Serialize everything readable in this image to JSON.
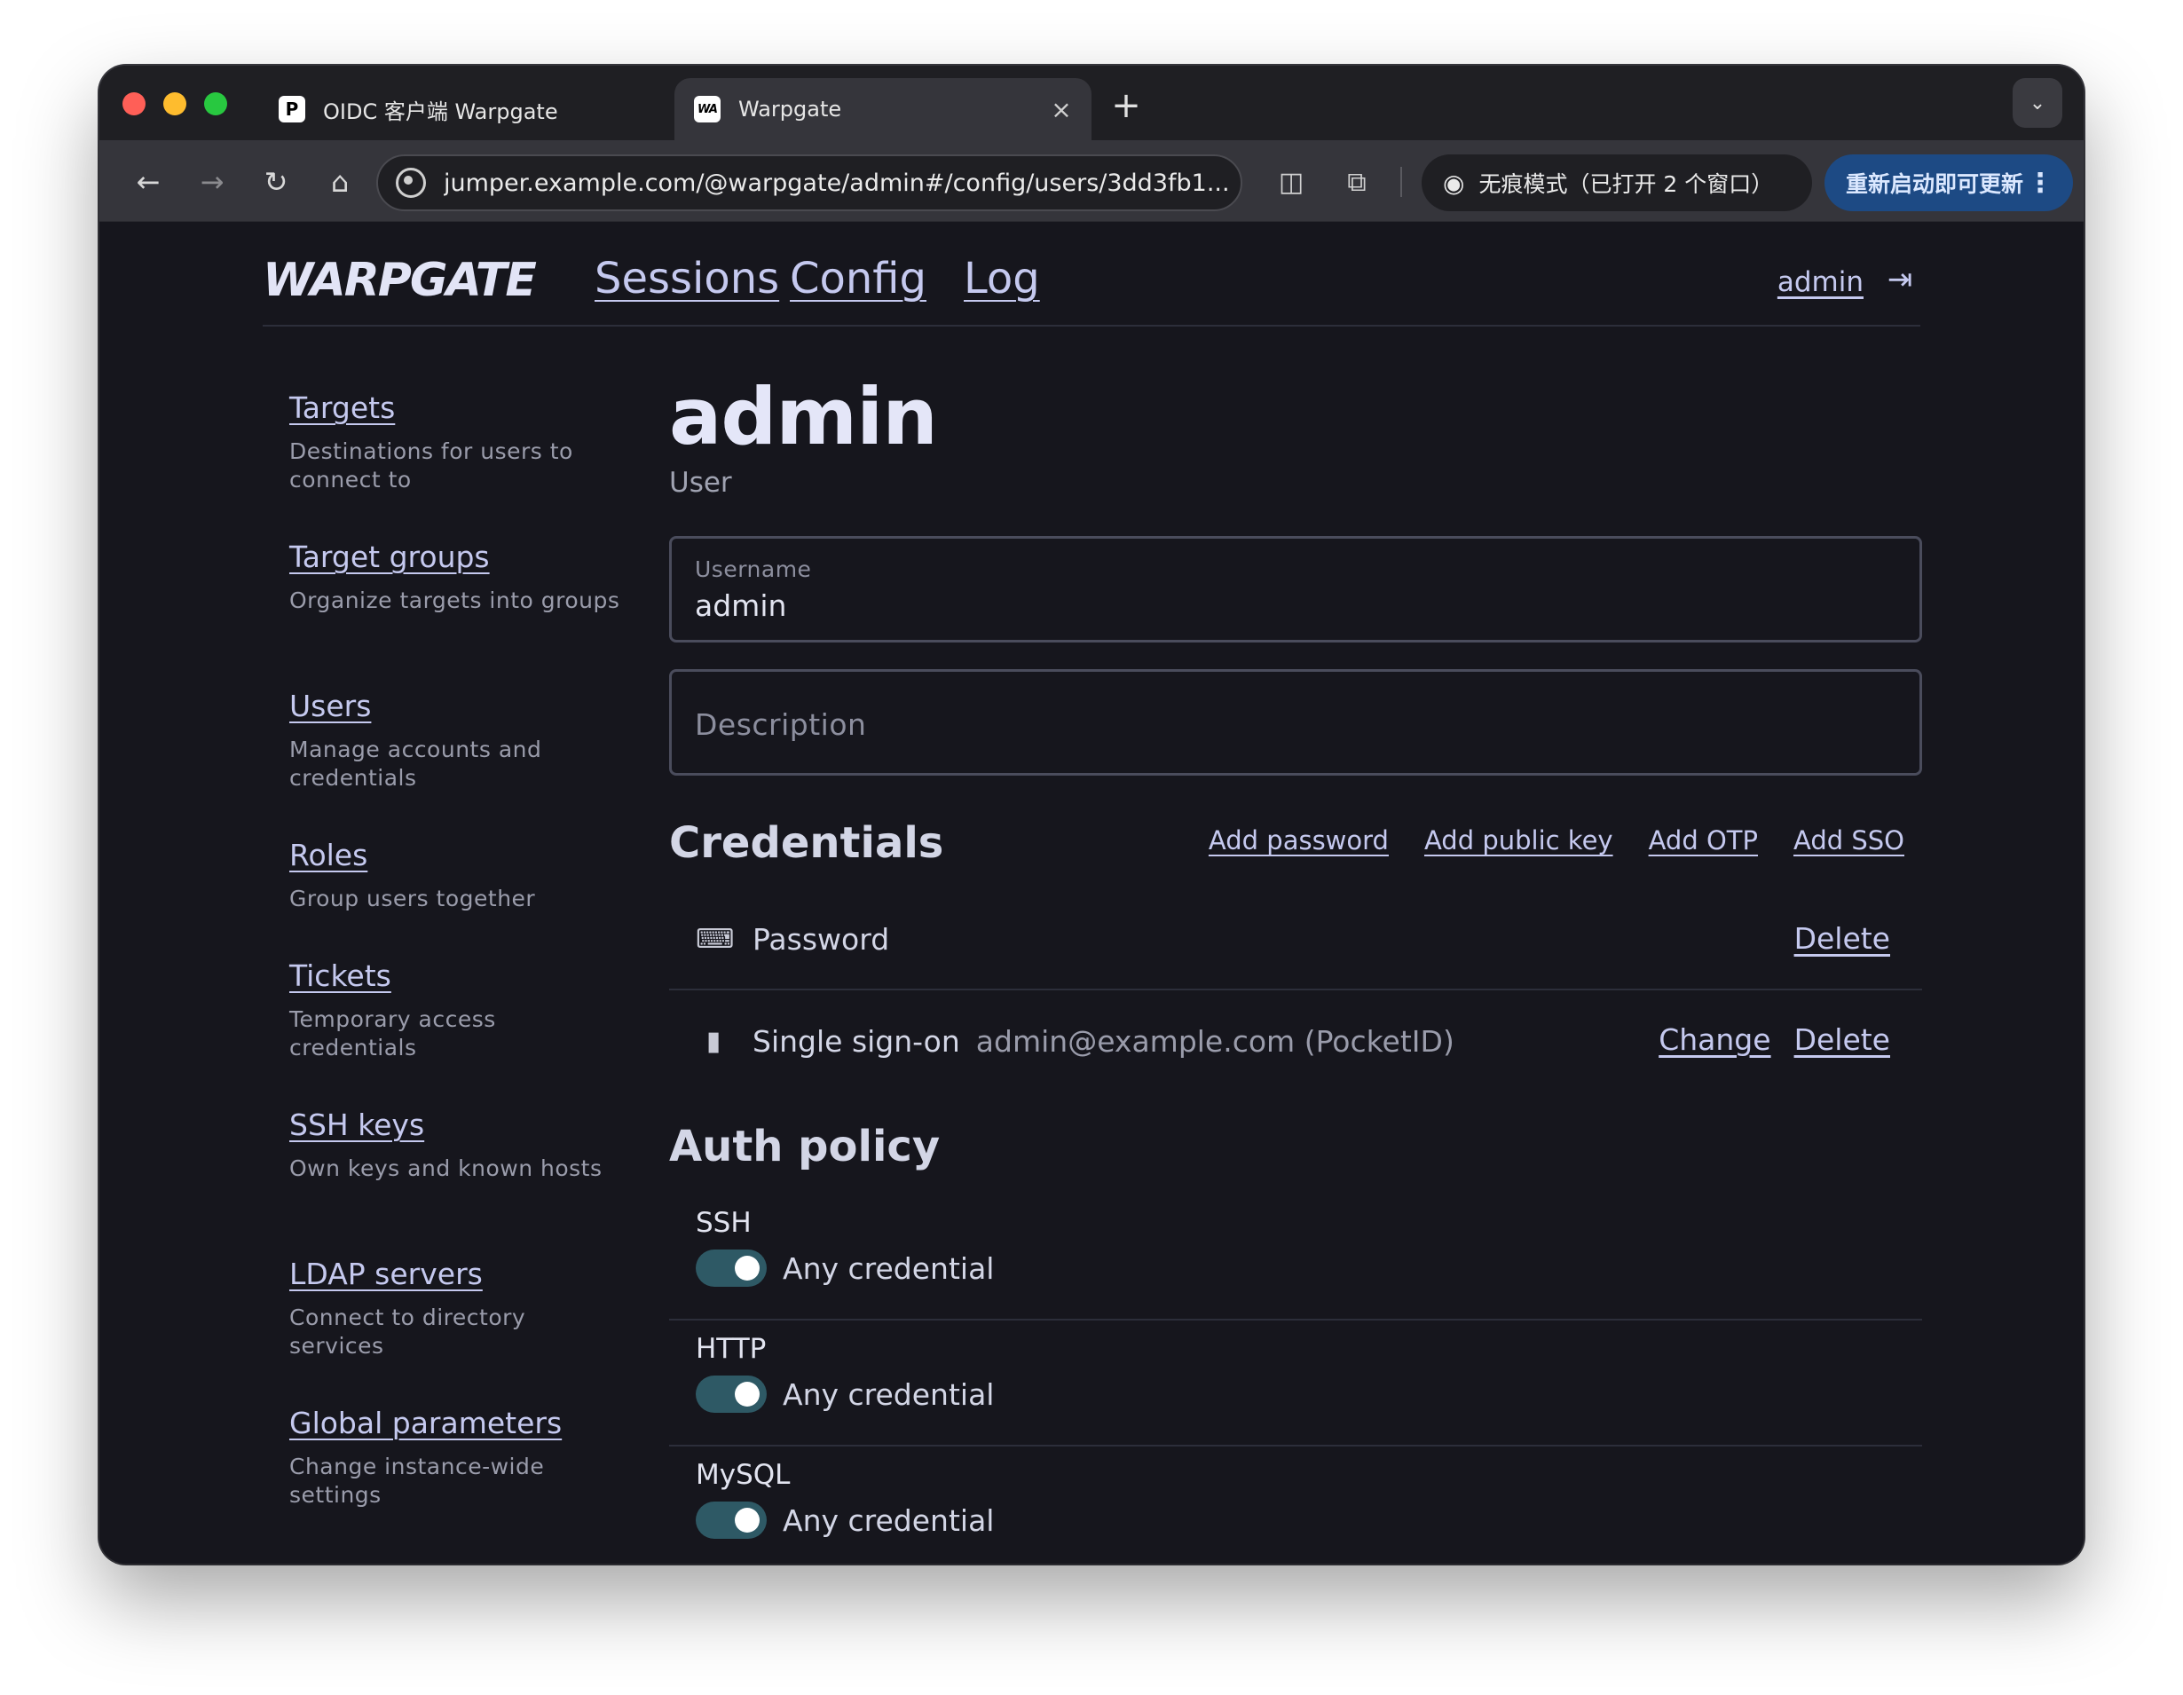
{
  "browser": {
    "tabs": [
      {
        "favicon": "P",
        "title": "OIDC 客户端 Warpgate",
        "close": "×"
      },
      {
        "favicon": "WA",
        "title": "Warpgate",
        "close": "×"
      }
    ],
    "new_tab": "+",
    "tab_dropdown": "⌄",
    "url": "jumper.example.com/@warpgate/admin#/config/users/3dd3fb1...",
    "incognito_label": "无痕模式（已打开 2 个窗口）",
    "update_label": "重新启动即可更新",
    "icons": {
      "back": "arrow-left-icon",
      "forward": "arrow-right-icon",
      "reload": "reload-icon",
      "home": "home-icon",
      "site_info": "site-info-icon",
      "reader": "reader-mode-icon",
      "extensions": "puzzle-icon",
      "incognito": "incognito-icon",
      "more": "more-vertical-icon"
    }
  },
  "header": {
    "logo": "WARPGATE",
    "nav": [
      "Sessions",
      "Config",
      "Log"
    ],
    "user": "admin",
    "logout_icon": "logout-icon"
  },
  "sidebar": {
    "items": [
      {
        "label": "Targets",
        "desc": "Destinations for users to connect to"
      },
      {
        "label": "Target groups",
        "desc": "Organize targets into groups"
      },
      {
        "label": "Users",
        "desc": "Manage accounts and credentials"
      },
      {
        "label": "Roles",
        "desc": "Group users together"
      },
      {
        "label": "Tickets",
        "desc": "Temporary access credentials"
      },
      {
        "label": "SSH keys",
        "desc": "Own keys and known hosts"
      },
      {
        "label": "LDAP servers",
        "desc": "Connect to directory services"
      },
      {
        "label": "Global parameters",
        "desc": "Change instance-wide settings"
      }
    ]
  },
  "main": {
    "title": "admin",
    "subtitle": "User",
    "username": {
      "label": "Username",
      "value": "admin"
    },
    "description": {
      "placeholder": "Description",
      "value": ""
    },
    "credentials": {
      "title": "Credentials",
      "actions": [
        "Add password",
        "Add public key",
        "Add OTP",
        "Add SSO"
      ],
      "rows": [
        {
          "icon": "keyboard-icon",
          "type": "Password",
          "detail": "",
          "actions": [
            "Delete"
          ]
        },
        {
          "icon": "id-badge-icon",
          "type": "Single sign-on",
          "detail": "admin@example.com (PocketID)",
          "actions": [
            "Change",
            "Delete"
          ]
        }
      ]
    },
    "auth_policy": {
      "title": "Auth policy",
      "rows": [
        {
          "protocol": "SSH",
          "label": "Any credential",
          "enabled": true
        },
        {
          "protocol": "HTTP",
          "label": "Any credential",
          "enabled": true
        },
        {
          "protocol": "MySQL",
          "label": "Any credential",
          "enabled": true
        }
      ]
    }
  }
}
